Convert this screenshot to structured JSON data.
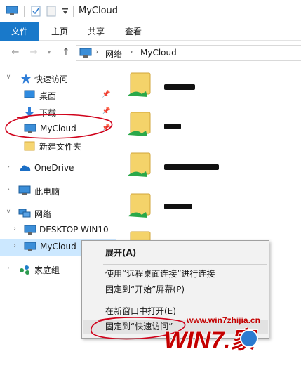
{
  "window": {
    "title": "MyCloud"
  },
  "ribbon": {
    "tabs": [
      "文件",
      "主页",
      "共享",
      "查看"
    ]
  },
  "address": {
    "crumbs": [
      "网络",
      "MyCloud"
    ]
  },
  "sidebar": {
    "items": [
      {
        "label": "快速访问",
        "icon": "star-icon"
      },
      {
        "label": "桌面",
        "icon": "desktop-icon"
      },
      {
        "label": "下载",
        "icon": "download-icon"
      },
      {
        "label": "MyCloud",
        "icon": "monitor-icon"
      },
      {
        "label": "新建文件夹",
        "icon": "folder-icon"
      },
      {
        "label": "OneDrive",
        "icon": "cloud-icon"
      },
      {
        "label": "此电脑",
        "icon": "computer-icon"
      },
      {
        "label": "网络",
        "icon": "network-icon"
      },
      {
        "label": "DESKTOP-WIN10",
        "icon": "monitor-icon"
      },
      {
        "label": "MyCloud",
        "icon": "monitor-icon"
      },
      {
        "label": "家庭组",
        "icon": "homegroup-icon"
      }
    ]
  },
  "context_menu": {
    "items": [
      {
        "label": "展开(A)"
      },
      {
        "label": "使用“远程桌面连接”进行连接"
      },
      {
        "label": "固定到“开始”屏幕(P)"
      },
      {
        "label": "在新窗口中打开(E)"
      },
      {
        "label": "固定到“快速访问”"
      }
    ]
  },
  "watermark": {
    "url": "www.win7zhijia.cn",
    "logo_text": "WIN7.家"
  },
  "colors": {
    "accent": "#1979ca",
    "selection": "#cce8ff",
    "annotation": "#d0021b",
    "watermark": "#c40000"
  }
}
